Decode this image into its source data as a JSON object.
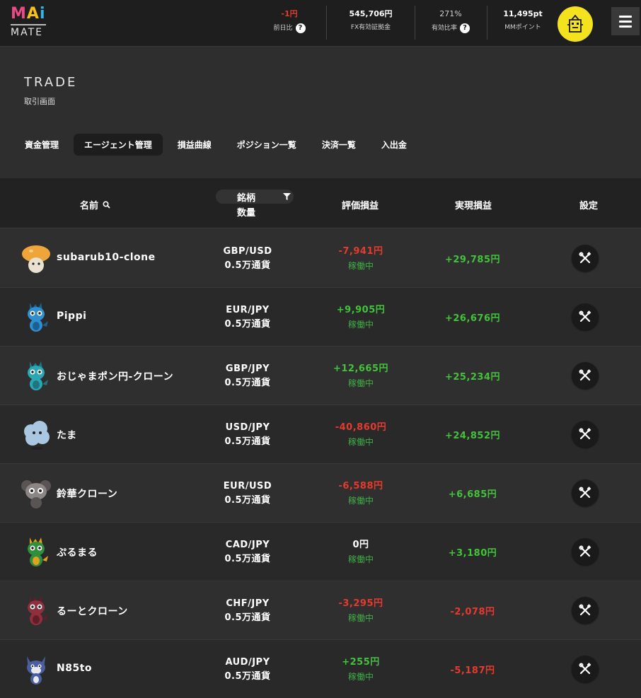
{
  "header": {
    "logo_top": "MAi",
    "logo_bottom": "MATE",
    "stats": [
      {
        "value": "-1円",
        "label": "前日比",
        "value_color": "#e63a2e",
        "has_help": true
      },
      {
        "value": "545,706円",
        "label": "FX有効証拠金",
        "value_color": "#ffffff",
        "has_help": false
      },
      {
        "value": "271%",
        "label": "有効比率",
        "value_color": "#cfcfcf",
        "has_help": true
      },
      {
        "value": "11,495pt",
        "label": "MMポイント",
        "value_color": "#ffffff",
        "has_help": false
      }
    ],
    "help_glyph": "?"
  },
  "page": {
    "title": "TRADE",
    "subtitle": "取引画面",
    "tabs": [
      {
        "label": "資金管理",
        "active": false
      },
      {
        "label": "エージェント管理",
        "active": true
      },
      {
        "label": "損益曲線",
        "active": false
      },
      {
        "label": "ポジション一覧",
        "active": false
      },
      {
        "label": "決済一覧",
        "active": false
      },
      {
        "label": "入出金",
        "active": false
      }
    ]
  },
  "table": {
    "headers": {
      "name": "名前",
      "symbol": "銘柄",
      "quantity": "数量",
      "eval": "評価損益",
      "realized": "実現損益",
      "settings": "設定"
    },
    "rows": [
      {
        "name": "subarub10-clone",
        "symbol": "GBP/USD",
        "qty": "0.5万通貨",
        "eval": "-7,941円",
        "eval_sign": "neg",
        "status": "稼働中",
        "realized": "+29,785円",
        "realized_sign": "pos",
        "character": "mushroom"
      },
      {
        "name": "Pippi",
        "symbol": "EUR/JPY",
        "qty": "0.5万通貨",
        "eval": "+9,905円",
        "eval_sign": "pos",
        "status": "稼働中",
        "realized": "+26,676円",
        "realized_sign": "pos",
        "character": "blue-dragon"
      },
      {
        "name": "おじゃまポン円-クローン",
        "symbol": "GBP/JPY",
        "qty": "0.5万通貨",
        "eval": "+12,665円",
        "eval_sign": "pos",
        "status": "稼働中",
        "realized": "+25,234円",
        "realized_sign": "pos",
        "character": "teal-dragon"
      },
      {
        "name": "たま",
        "symbol": "USD/JPY",
        "qty": "0.5万通貨",
        "eval": "-40,860円",
        "eval_sign": "neg",
        "status": "稼働中",
        "realized": "+24,852円",
        "realized_sign": "pos",
        "character": "cloud"
      },
      {
        "name": "鈴華クローン",
        "symbol": "EUR/USD",
        "qty": "0.5万通貨",
        "eval": "-6,588円",
        "eval_sign": "neg",
        "status": "稼働中",
        "realized": "+6,685円",
        "realized_sign": "pos",
        "character": "mouse"
      },
      {
        "name": "ぷるまる",
        "symbol": "CAD/JPY",
        "qty": "0.5万通貨",
        "eval": "0円",
        "eval_sign": "zero",
        "status": "稼働中",
        "realized": "+3,180円",
        "realized_sign": "pos",
        "character": "green-dragon"
      },
      {
        "name": "るーとクローン",
        "symbol": "CHF/JPY",
        "qty": "0.5万通貨",
        "eval": "-3,295円",
        "eval_sign": "neg",
        "status": "稼働中",
        "realized": "-2,078円",
        "realized_sign": "neg",
        "character": "red-dragon"
      },
      {
        "name": "N85to",
        "symbol": "AUD/JPY",
        "qty": "0.5万通貨",
        "eval": "+255円",
        "eval_sign": "pos",
        "status": "稼働中",
        "realized": "-5,187円",
        "realized_sign": "neg",
        "character": "wolf"
      }
    ]
  },
  "colors": {
    "negative": "#e63a2e",
    "positive": "#43c23c",
    "status": "#3fae46",
    "avatar_bg": "#f4e21f"
  }
}
